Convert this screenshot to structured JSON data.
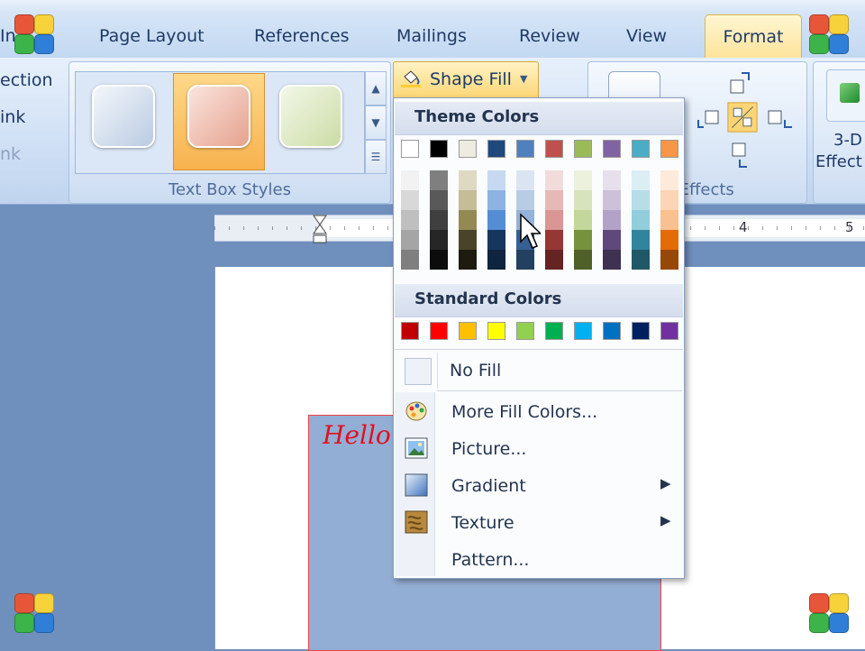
{
  "ribbon": {
    "tabs": [
      "In",
      "Page Layout",
      "References",
      "Mailings",
      "Review",
      "View",
      "Format"
    ],
    "active_tab": "Format",
    "left_commands": [
      "ection",
      "ink",
      "nk"
    ],
    "text_box_styles_label": "Text Box Styles",
    "shape_fill_label": "Shape Fill",
    "shadow_effects_label": "w Effects",
    "three_d_label_line1": "3-D",
    "three_d_label_line2": "Effect"
  },
  "ruler": {
    "numbers": [
      "4",
      "5"
    ]
  },
  "document": {
    "textbox_text": "Hello"
  },
  "shape_fill_menu": {
    "theme_colors_heading": "Theme Colors",
    "theme_top_row": [
      "#ffffff",
      "#000000",
      "#eeece1",
      "#1f497d",
      "#4f81bd",
      "#c0504d",
      "#9bbb59",
      "#8064a2",
      "#4bacc6",
      "#f79646"
    ],
    "theme_shades": [
      [
        "#f2f2f2",
        "#d8d8d8",
        "#bfbfbf",
        "#a5a5a5",
        "#7f7f7f"
      ],
      [
        "#7f7f7f",
        "#595959",
        "#3f3f3f",
        "#262626",
        "#0c0c0c"
      ],
      [
        "#ddd9c3",
        "#c4bd97",
        "#938953",
        "#494429",
        "#1d1b10"
      ],
      [
        "#c6d9f0",
        "#8db3e2",
        "#548dd4",
        "#17365d",
        "#0f243e"
      ],
      [
        "#dbe5f1",
        "#b8cce4",
        "#95b3d7",
        "#366092",
        "#244061"
      ],
      [
        "#f2dcdb",
        "#e5b9b7",
        "#d99694",
        "#953734",
        "#632423"
      ],
      [
        "#ebf1dd",
        "#d7e3bc",
        "#c3d69b",
        "#76923c",
        "#4f6128"
      ],
      [
        "#e5e0ec",
        "#ccc1d9",
        "#b2a2c7",
        "#5f497a",
        "#3f3151"
      ],
      [
        "#dbeef3",
        "#b7dde8",
        "#92cddc",
        "#31859b",
        "#205867"
      ],
      [
        "#fdeada",
        "#fbd5b5",
        "#fac08f",
        "#e36c09",
        "#974806"
      ]
    ],
    "standard_colors_heading": "Standard Colors",
    "standard_colors": [
      "#c00000",
      "#ff0000",
      "#ffc000",
      "#ffff00",
      "#92d050",
      "#00b050",
      "#00b0f0",
      "#0070c0",
      "#002060",
      "#7030a0"
    ],
    "no_fill_label": "No Fill",
    "items": [
      {
        "label": "More Fill Colors...",
        "icon": "palette-icon",
        "submenu": false
      },
      {
        "label": "Picture...",
        "icon": "picture-icon",
        "submenu": false
      },
      {
        "label": "Gradient",
        "icon": "gradient-icon",
        "submenu": true
      },
      {
        "label": "Texture",
        "icon": "texture-icon",
        "submenu": true
      },
      {
        "label": "Pattern...",
        "icon": "",
        "submenu": false
      }
    ]
  },
  "watermark_icon": "four-squares-logo-icon"
}
